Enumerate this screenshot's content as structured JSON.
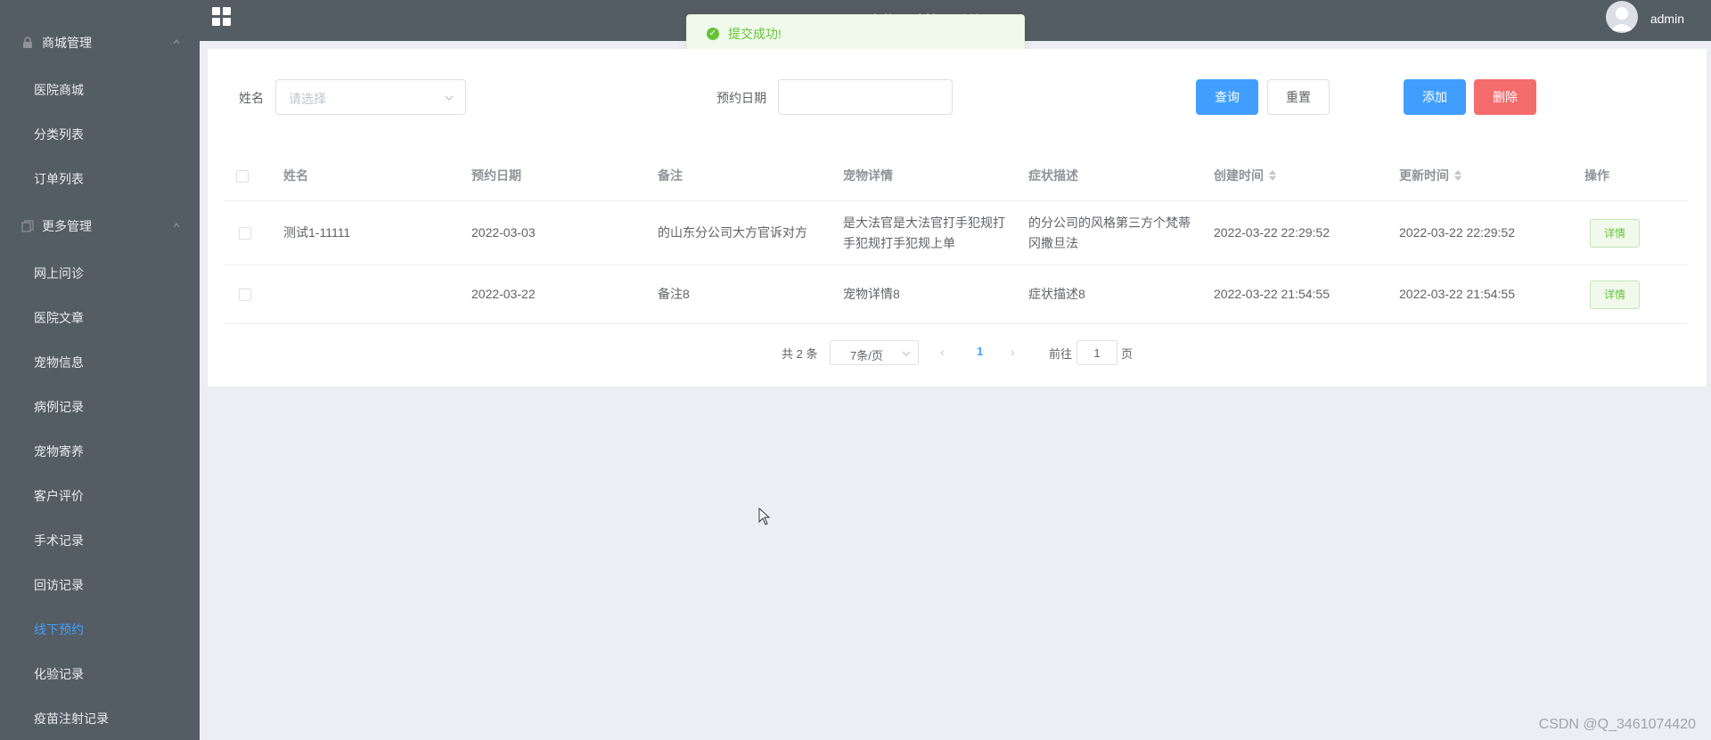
{
  "sidebar": {
    "sections": [
      {
        "label": "商城管理"
      },
      {
        "label": "更多管理"
      }
    ],
    "items": [
      {
        "label": "医院商城"
      },
      {
        "label": "分类列表"
      },
      {
        "label": "订单列表"
      },
      {
        "label": "网上问诊"
      },
      {
        "label": "医院文章"
      },
      {
        "label": "宠物信息"
      },
      {
        "label": "病例记录"
      },
      {
        "label": "宠物寄养"
      },
      {
        "label": "客户评价"
      },
      {
        "label": "手术记录"
      },
      {
        "label": "回访记录"
      },
      {
        "label": "线下预约",
        "active": true
      },
      {
        "label": "化验记录"
      },
      {
        "label": "疫苗注射记录"
      }
    ],
    "active_color": "#409eff"
  },
  "topbar": {
    "title": "宠物医院管理系统",
    "user": "admin"
  },
  "toast": {
    "message": "提交成功!"
  },
  "filters": {
    "name_label": "姓名",
    "name_placeholder": "请选择",
    "date_label": "预约日期",
    "date_value": ""
  },
  "buttons": {
    "query": "查询",
    "reset": "重置",
    "add": "添加",
    "delete": "删除"
  },
  "table": {
    "headers": {
      "name": "姓名",
      "date": "预约日期",
      "note": "备注",
      "pet_detail": "宠物详情",
      "symptom": "症状描述",
      "created": "创建时间",
      "updated": "更新时间",
      "action": "操作"
    },
    "rows": [
      {
        "name": "测试1-11111",
        "date": "2022-03-03",
        "note": "的山东分公司大方官诉对方",
        "pet_detail": "是大法官是大法官打手犯规打手犯规打手犯规上单",
        "symptom": "的分公司的风格第三方个梵蒂冈撒旦法",
        "created": "2022-03-22 22:29:52",
        "updated": "2022-03-22 22:29:52",
        "action": "详情"
      },
      {
        "name": "",
        "date": "2022-03-22",
        "note": "备注8",
        "pet_detail": "宠物详情8",
        "symptom": "症状描述8",
        "created": "2022-03-22 21:54:55",
        "updated": "2022-03-22 21:54:55",
        "action": "详情"
      }
    ]
  },
  "pagination": {
    "total": "共 2 条",
    "page_size": "7条/页",
    "current_page": "1",
    "goto_label": "前往",
    "goto_value": "1",
    "page_suffix": "页"
  },
  "watermark": "CSDN @Q_3461074420"
}
